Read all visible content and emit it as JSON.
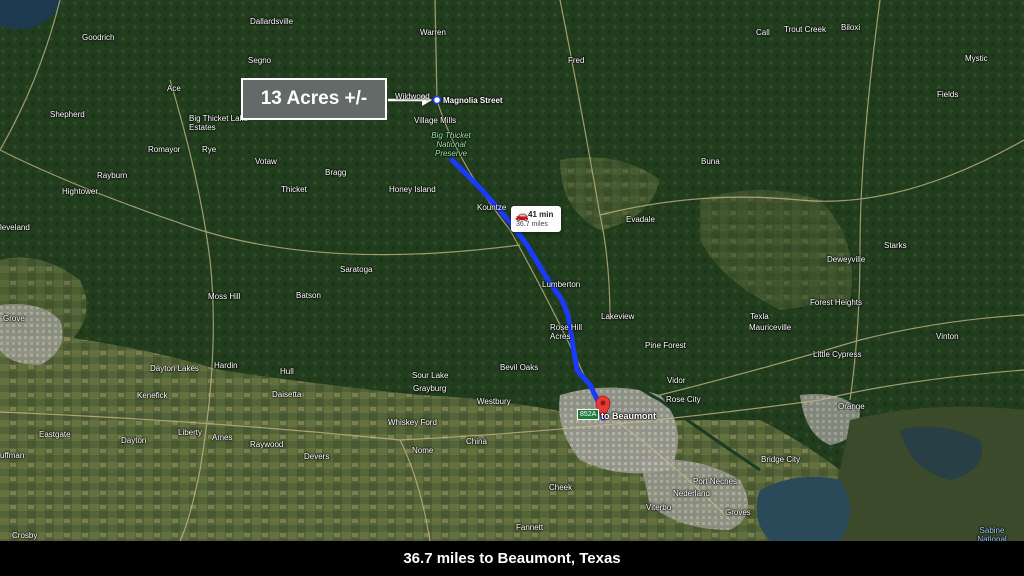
{
  "caption": "36.7 miles to Beaumont, Texas",
  "callout": {
    "label": "13 Acres +/-"
  },
  "marker": {
    "label": "Magnolia Street"
  },
  "destination": {
    "label": "to Beaumont"
  },
  "route_info": {
    "time": "41 min",
    "distance": "36.7 miles",
    "route_color": "#1a3bff"
  },
  "park_label": "Big Thicket National Preserve",
  "exit_shield": "852A",
  "colors": {
    "forest": "#1f3a1c",
    "caption_bar": "#000000",
    "callout_bg": "#6e7272"
  },
  "places": [
    {
      "id": "dallardsville",
      "name": "Dallardsville"
    },
    {
      "id": "warren",
      "name": "Warren"
    },
    {
      "id": "goodrich",
      "name": "Goodrich"
    },
    {
      "id": "segno",
      "name": "Segno"
    },
    {
      "id": "fred",
      "name": "Fred"
    },
    {
      "id": "ace",
      "name": "Ace"
    },
    {
      "id": "shepherd",
      "name": "Shepherd"
    },
    {
      "id": "big-thicket-lake-estates",
      "name": "Big Thicket Lake Estates"
    },
    {
      "id": "village-mills",
      "name": "Village Mills"
    },
    {
      "id": "wildwood",
      "name": "Wildwood"
    },
    {
      "id": "romayor",
      "name": "Romayor"
    },
    {
      "id": "rye",
      "name": "Rye"
    },
    {
      "id": "votaw",
      "name": "Votaw"
    },
    {
      "id": "rayburn",
      "name": "Rayburn"
    },
    {
      "id": "bragg",
      "name": "Bragg"
    },
    {
      "id": "hightower",
      "name": "Hightower"
    },
    {
      "id": "thicket",
      "name": "Thicket"
    },
    {
      "id": "honey-island",
      "name": "Honey Island"
    },
    {
      "id": "kountze",
      "name": "Kountze"
    },
    {
      "id": "cleveland",
      "name": "leveland"
    },
    {
      "id": "saratoga",
      "name": "Saratoga"
    },
    {
      "id": "lumberton",
      "name": "Lumberton"
    },
    {
      "id": "moss-hill",
      "name": "Moss Hill"
    },
    {
      "id": "batson",
      "name": "Batson"
    },
    {
      "id": "grove",
      "name": "Grove"
    },
    {
      "id": "rose-hill-acres",
      "name": "Rose Hill Acres"
    },
    {
      "id": "lakeview",
      "name": "Lakeview"
    },
    {
      "id": "dayton-lakes",
      "name": "Dayton Lakes"
    },
    {
      "id": "hardin",
      "name": "Hardin"
    },
    {
      "id": "hull",
      "name": "Hull"
    },
    {
      "id": "sour-lake",
      "name": "Sour Lake"
    },
    {
      "id": "bevil-oaks",
      "name": "Bevil Oaks"
    },
    {
      "id": "grayburg",
      "name": "Grayburg"
    },
    {
      "id": "pine-forest",
      "name": "Pine Forest"
    },
    {
      "id": "kenefick",
      "name": "Kenefick"
    },
    {
      "id": "daisetta",
      "name": "Daisetta"
    },
    {
      "id": "westbury",
      "name": "Westbury"
    },
    {
      "id": "whiskey-ford",
      "name": "Whiskey Ford"
    },
    {
      "id": "eastgate",
      "name": "Eastgate"
    },
    {
      "id": "liberty",
      "name": "Liberty"
    },
    {
      "id": "ames",
      "name": "Ames"
    },
    {
      "id": "dayton",
      "name": "Dayton"
    },
    {
      "id": "raywood",
      "name": "Raywood"
    },
    {
      "id": "china",
      "name": "China"
    },
    {
      "id": "nome",
      "name": "Nome"
    },
    {
      "id": "devers",
      "name": "Devers"
    },
    {
      "id": "huffman",
      "name": "uffman"
    },
    {
      "id": "cheek",
      "name": "Cheek"
    },
    {
      "id": "fannett",
      "name": "Fannett"
    },
    {
      "id": "crosby",
      "name": "Crosby"
    },
    {
      "id": "call",
      "name": "Call"
    },
    {
      "id": "trout-creek",
      "name": "Trout Creek"
    },
    {
      "id": "biloxi",
      "name": "Biloxi"
    },
    {
      "id": "mystic",
      "name": "Mystic"
    },
    {
      "id": "fields",
      "name": "Fields"
    },
    {
      "id": "buna",
      "name": "Buna"
    },
    {
      "id": "evadale",
      "name": "Evadale"
    },
    {
      "id": "starks",
      "name": "Starks"
    },
    {
      "id": "deweyville",
      "name": "Deweyville"
    },
    {
      "id": "forest-heights",
      "name": "Forest Heights"
    },
    {
      "id": "texla",
      "name": "Texla"
    },
    {
      "id": "mauriceville",
      "name": "Mauriceville"
    },
    {
      "id": "vinton",
      "name": "Vinton"
    },
    {
      "id": "little-cypress",
      "name": "Little Cypress"
    },
    {
      "id": "vidor",
      "name": "Vidor"
    },
    {
      "id": "rose-city",
      "name": "Rose City"
    },
    {
      "id": "orange",
      "name": "Orange"
    },
    {
      "id": "bridge-city",
      "name": "Bridge City"
    },
    {
      "id": "port-neches",
      "name": "Port Neches"
    },
    {
      "id": "nederland",
      "name": "Nederland"
    },
    {
      "id": "viterbo",
      "name": "Viterbo"
    },
    {
      "id": "groves",
      "name": "Groves"
    },
    {
      "id": "sabine-national",
      "name": "Sabine National"
    }
  ]
}
